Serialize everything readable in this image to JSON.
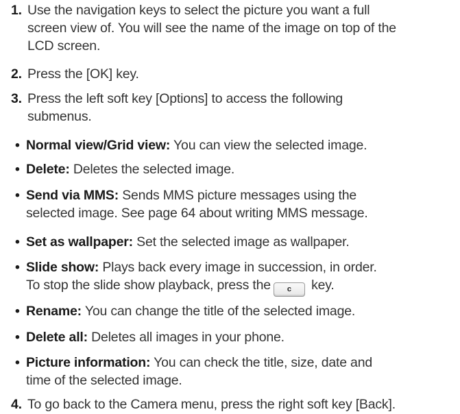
{
  "steps": [
    {
      "num": "1.",
      "text": "Use the navigation keys to select the picture you want a full\nscreen view of. You will see the name of the image on top of the\nLCD screen."
    },
    {
      "num": "2.",
      "text": "Press the [OK] key."
    },
    {
      "num": "3.",
      "text": "Press the left soft key [Options] to access the following\nsubmenus."
    },
    {
      "num": "4.",
      "text": "To go back to the Camera menu, press the right soft key [Back]."
    }
  ],
  "submenus": [
    {
      "term": "Normal view/Grid view:",
      "desc": " You can view the selected image."
    },
    {
      "term": "Delete:",
      "desc": " Deletes the selected image."
    },
    {
      "term": "Send via MMS:",
      "desc": " Sends MMS picture messages using the\nselected image. See page 64 about writing MMS message."
    },
    {
      "term": "Set as wallpaper:",
      "desc": " Set the selected image as wallpaper."
    },
    {
      "term": "Slide show:",
      "desc": " Plays back every image in succession, in order.\nTo stop the slide show playback, press the",
      "key_label": "c",
      "desc_after": " key."
    },
    {
      "term": "Rename:",
      "desc": " You can change the title of the selected image."
    },
    {
      "term": "Delete all:",
      "desc": " Deletes all images in your phone."
    },
    {
      "term": "Picture information:",
      "desc": " You can check the title, size, date and\ntime of the selected image."
    }
  ],
  "bullet_char": "•"
}
